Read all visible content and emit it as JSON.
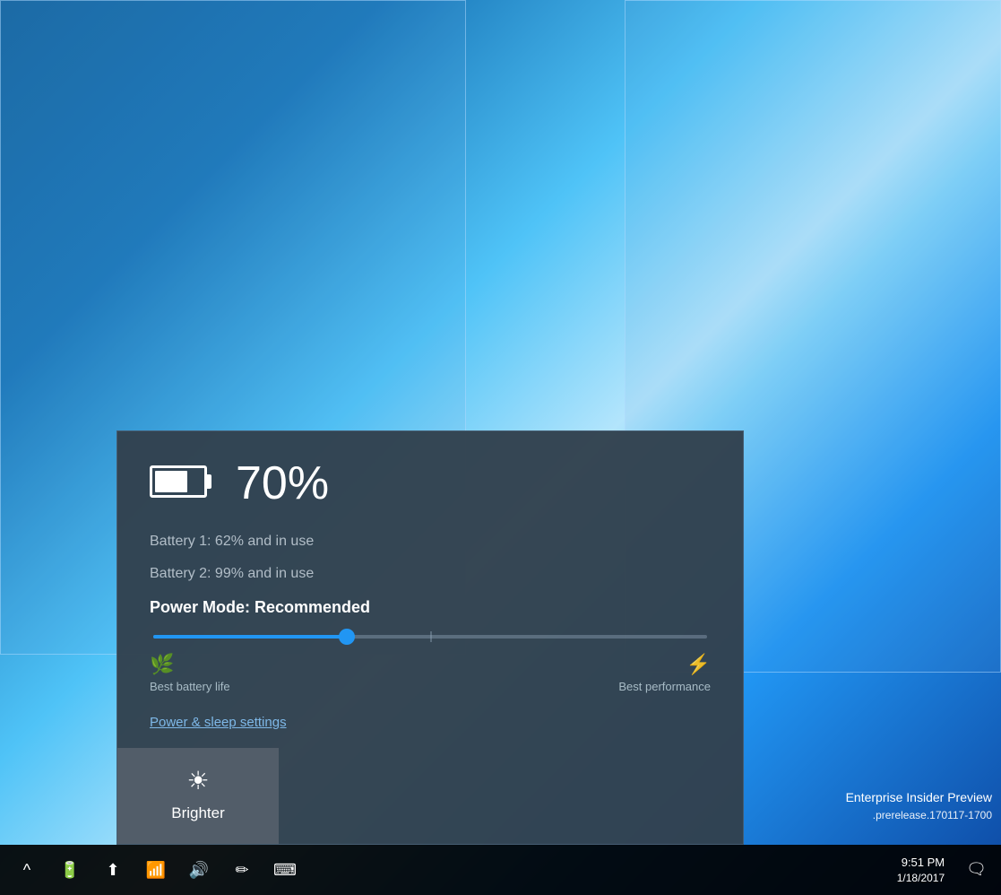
{
  "desktop": {
    "background": "#1565a0"
  },
  "battery_popup": {
    "percent": "70%",
    "battery1_label": "Battery 1: 62% and in use",
    "battery2_label": "Battery 2: 99% and in use",
    "power_mode_label": "Power Mode: Recommended",
    "slider_fill_pct": 35,
    "best_battery_label": "Best battery life",
    "best_performance_label": "Best performance",
    "power_settings_link": "Power & sleep settings",
    "brighter_label": "Brighter"
  },
  "taskbar": {
    "chevron_label": "^",
    "time": "9:51 PM",
    "date": "1/18/2017",
    "notification_label": "□"
  },
  "watermark": {
    "line1": "Enterprise Insider Preview",
    "line2": ".prerelease.170117-1700"
  }
}
